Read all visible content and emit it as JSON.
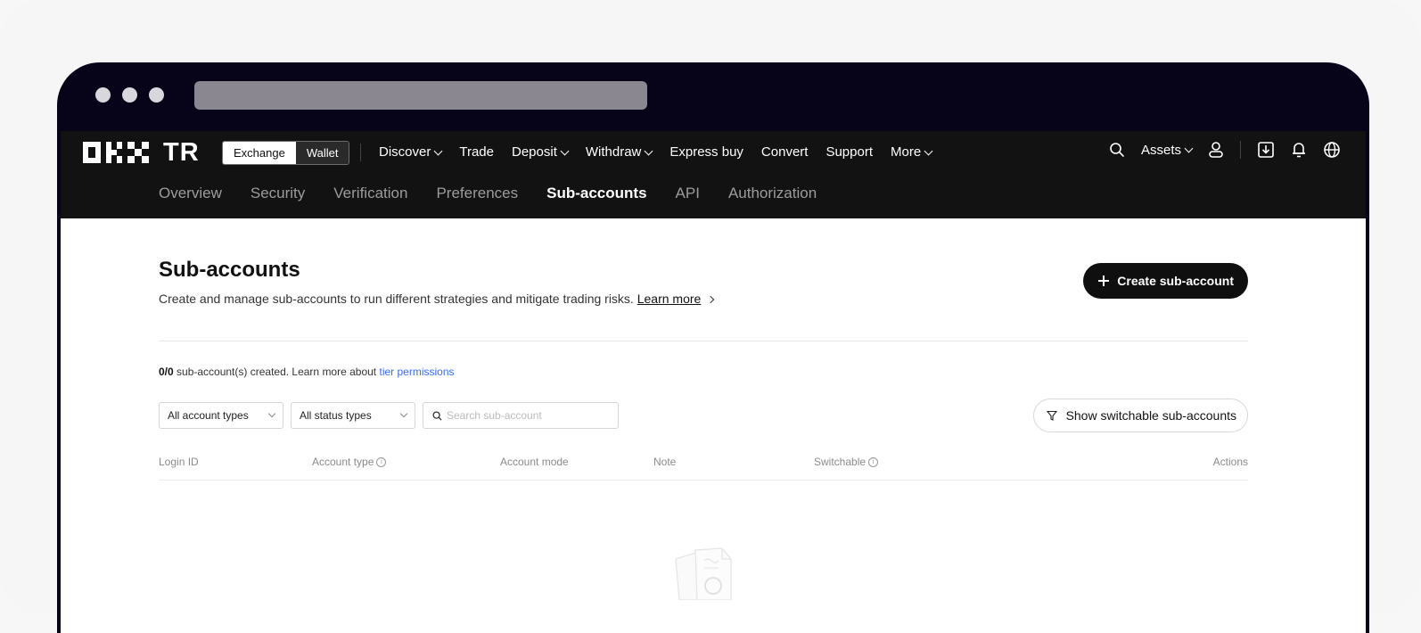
{
  "brand": {
    "logo_text": "TR"
  },
  "switcher": {
    "exchange": "Exchange",
    "wallet": "Wallet"
  },
  "main_menu": [
    {
      "label": "Discover",
      "dropdown": true
    },
    {
      "label": "Trade",
      "dropdown": false
    },
    {
      "label": "Deposit",
      "dropdown": true
    },
    {
      "label": "Withdraw",
      "dropdown": true
    },
    {
      "label": "Express buy",
      "dropdown": false
    },
    {
      "label": "Convert",
      "dropdown": false
    },
    {
      "label": "Support",
      "dropdown": false
    },
    {
      "label": "More",
      "dropdown": true
    }
  ],
  "right_tools": {
    "assets": "Assets",
    "icons": [
      "search-icon",
      "user-icon",
      "download-icon",
      "bell-icon",
      "globe-icon"
    ]
  },
  "subnav": {
    "tabs": [
      "Overview",
      "Security",
      "Verification",
      "Preferences",
      "Sub-accounts",
      "API",
      "Authorization"
    ],
    "active": "Sub-accounts"
  },
  "page": {
    "title": "Sub-accounts",
    "description": "Create and manage sub-accounts to run different strategies and mitigate trading risks.",
    "learn_more": "Learn more",
    "create_button": "Create sub-account",
    "count_value": "0/0",
    "count_text": " sub-account(s) created. Learn more about ",
    "count_link": "tier permissions"
  },
  "filters": {
    "account_types": "All account types",
    "status_types": "All status types",
    "search_placeholder": "Search sub-account",
    "switchable_button": "Show switchable sub-accounts"
  },
  "table": {
    "columns": [
      "Login ID",
      "Account type",
      "Account mode",
      "Note",
      "Switchable",
      "Actions"
    ],
    "rows": []
  },
  "colors": {
    "nav_bg": "#121212",
    "link_blue": "#3a6df0",
    "button_dark": "#0f0f0f"
  }
}
